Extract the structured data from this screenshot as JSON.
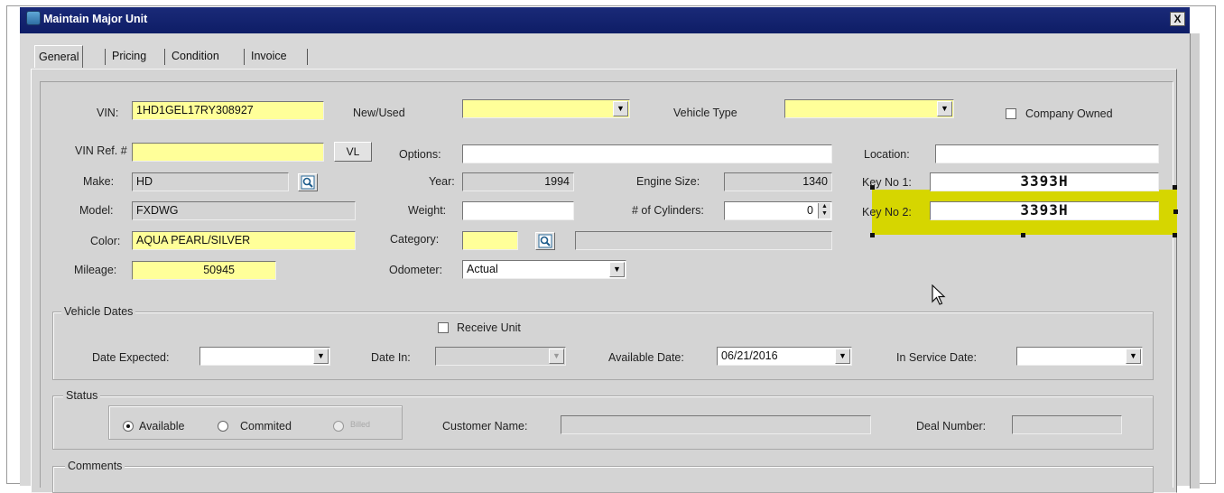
{
  "window": {
    "title": "Maintain Major Unit",
    "close_label": "X"
  },
  "tabs": [
    {
      "label": "General",
      "active": true
    },
    {
      "label": "Pricing",
      "active": false
    },
    {
      "label": "Condition",
      "active": false
    },
    {
      "label": "Invoice",
      "active": false
    }
  ],
  "top_row": {
    "vin_label": "VIN:",
    "vin_value": "1HD1GEL17RY308927",
    "new_used_label": "New/Used",
    "new_used_value": "",
    "vehicle_type_label": "Vehicle Type",
    "vehicle_type_value": "",
    "company_owned_label": "Company Owned",
    "company_owned_checked": false
  },
  "left_col": {
    "vin_ref_label": "VIN Ref. #",
    "vin_ref_value": "",
    "vl_button": "VL",
    "make_label": "Make:",
    "make_value": "HD",
    "model_label": "Model:",
    "model_value": "FXDWG",
    "color_label": "Color:",
    "color_value": "AQUA PEARL/SILVER",
    "mileage_label": "Mileage:",
    "mileage_value": "50945"
  },
  "mid_col": {
    "options_label": "Options:",
    "options_value": "",
    "year_label": "Year:",
    "year_value": "1994",
    "weight_label": "Weight:",
    "weight_value": "",
    "category_label": "Category:",
    "category_value": "",
    "category_desc": "",
    "odometer_label": "Odometer:",
    "odometer_value": "Actual",
    "engine_size_label": "Engine Size:",
    "engine_size_value": "1340",
    "cylinders_label": "# of Cylinders:",
    "cylinders_value": "0"
  },
  "right_col": {
    "location_label": "Location:",
    "location_value": "",
    "key1_label": "Key No 1:",
    "key1_value": "3393H",
    "key2_label": "Key No 2:",
    "key2_value": "3393H"
  },
  "vehicle_dates": {
    "title": "Vehicle Dates",
    "receive_unit_label": "Receive Unit",
    "receive_unit_checked": false,
    "date_expected_label": "Date Expected:",
    "date_expected_value": "",
    "date_in_label": "Date In:",
    "date_in_value": "",
    "available_date_label": "Available Date:",
    "available_date_value": "06/21/2016",
    "in_service_date_label": "In Service Date:",
    "in_service_date_value": ""
  },
  "status": {
    "title": "Status",
    "options": [
      "Available",
      "Commited",
      "Billed"
    ],
    "selected": "Available",
    "customer_name_label": "Customer Name:",
    "customer_name_value": "",
    "deal_number_label": "Deal Number:",
    "deal_number_value": ""
  },
  "comments": {
    "title": "Comments"
  },
  "icons": {
    "dropdown": "▼",
    "search": "search-icon",
    "spin_up": "▲",
    "spin_down": "▼"
  },
  "colors": {
    "titlebar": "#0e1d66",
    "required_field": "#ffff99",
    "highlight": "#d6d600"
  }
}
